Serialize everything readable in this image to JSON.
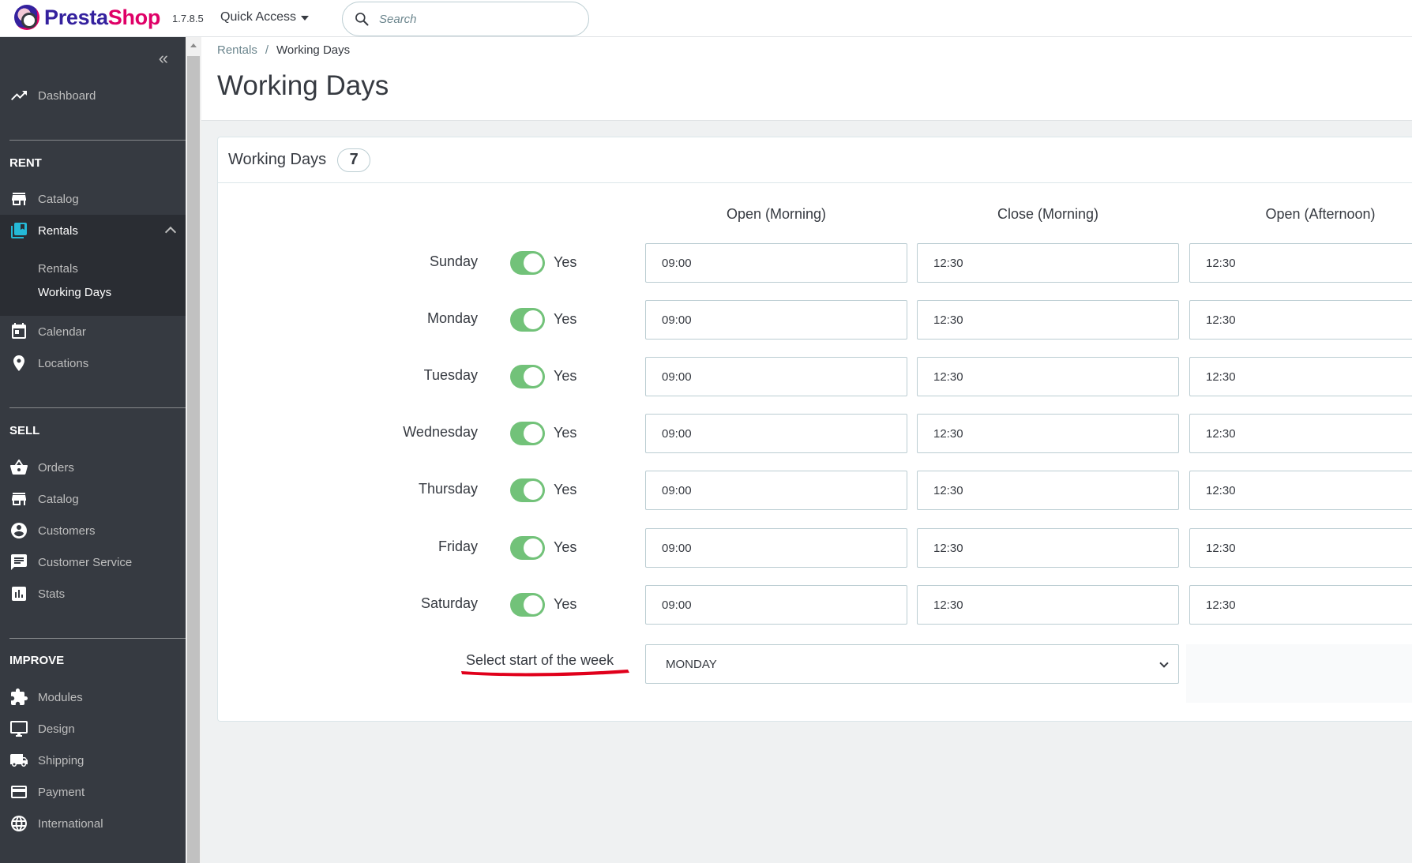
{
  "header": {
    "logo_presta": "Presta",
    "logo_shop": "Shop",
    "version": "1.7.8.5",
    "quick_access": "Quick Access",
    "search_placeholder": "Search"
  },
  "sidebar": {
    "dashboard": "Dashboard",
    "section_rent": "RENT",
    "rent_items": [
      "Catalog",
      "Rentals"
    ],
    "rentals_sub": [
      "Rentals",
      "Working Days"
    ],
    "rent_more": [
      "Calendar",
      "Locations"
    ],
    "section_sell": "SELL",
    "sell_items": [
      "Orders",
      "Catalog",
      "Customers",
      "Customer Service",
      "Stats"
    ],
    "section_improve": "IMPROVE",
    "improve_items": [
      "Modules",
      "Design",
      "Shipping",
      "Payment",
      "International"
    ]
  },
  "breadcrumb": {
    "parent": "Rentals",
    "separator": "/",
    "current": "Working Days"
  },
  "page_title": "Working Days",
  "panel": {
    "title": "Working Days",
    "count": "7",
    "columns": [
      "Open (Morning)",
      "Close (Morning)",
      "Open (Afternoon)"
    ],
    "rows": [
      {
        "day": "Sunday",
        "enabled": "Yes",
        "open_morning": "09:00",
        "close_morning": "12:30",
        "open_afternoon": "12:30"
      },
      {
        "day": "Monday",
        "enabled": "Yes",
        "open_morning": "09:00",
        "close_morning": "12:30",
        "open_afternoon": "12:30"
      },
      {
        "day": "Tuesday",
        "enabled": "Yes",
        "open_morning": "09:00",
        "close_morning": "12:30",
        "open_afternoon": "12:30"
      },
      {
        "day": "Wednesday",
        "enabled": "Yes",
        "open_morning": "09:00",
        "close_morning": "12:30",
        "open_afternoon": "12:30"
      },
      {
        "day": "Thursday",
        "enabled": "Yes",
        "open_morning": "09:00",
        "close_morning": "12:30",
        "open_afternoon": "12:30"
      },
      {
        "day": "Friday",
        "enabled": "Yes",
        "open_morning": "09:00",
        "close_morning": "12:30",
        "open_afternoon": "12:30"
      },
      {
        "day": "Saturday",
        "enabled": "Yes",
        "open_morning": "09:00",
        "close_morning": "12:30",
        "open_afternoon": "12:30"
      }
    ],
    "week_start_label": "Select start of the week",
    "week_start_value": "MONDAY"
  },
  "colors": {
    "sidebar_bg": "#363a41",
    "toggle_on": "#72c279",
    "brand_purple": "#34219e",
    "brand_pink": "#df0067",
    "annotation_red": "#e0001b"
  },
  "icons": {
    "dashboard": "trending-up-icon",
    "catalog": "store-icon",
    "rentals": "book-icon",
    "calendar": "calendar-icon",
    "locations": "map-pin-icon",
    "orders": "basket-icon",
    "customers": "account-circle-icon",
    "customer_service": "chat-icon",
    "stats": "bar-chart-icon",
    "modules": "puzzle-icon",
    "design": "monitor-icon",
    "shipping": "truck-icon",
    "payment": "credit-card-icon",
    "international": "globe-icon"
  }
}
